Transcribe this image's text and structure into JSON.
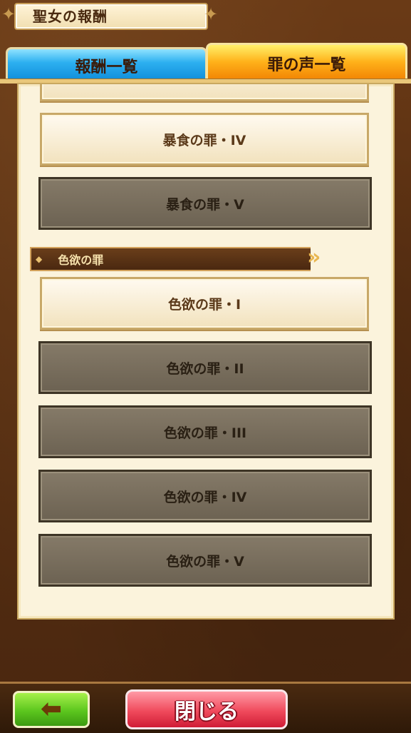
{
  "header": {
    "title": "聖女の報酬"
  },
  "tabs": [
    {
      "label": "報酬一覧",
      "color": "#2db0f0",
      "active": false
    },
    {
      "label": "罪の声一覧",
      "color": "#ffb21a",
      "active": true
    }
  ],
  "list": {
    "items_top": [
      {
        "label": "",
        "style": "light"
      },
      {
        "label": "暴食の罪・IV",
        "style": "light"
      },
      {
        "label": "暴食の罪・V",
        "style": "dark"
      }
    ],
    "section": {
      "label": "色欲の罪"
    },
    "items_section": [
      {
        "label": "色欲の罪・I",
        "style": "light"
      },
      {
        "label": "色欲の罪・II",
        "style": "dark"
      },
      {
        "label": "色欲の罪・III",
        "style": "dark"
      },
      {
        "label": "色欲の罪・IV",
        "style": "dark"
      },
      {
        "label": "色欲の罪・V",
        "style": "dark"
      }
    ]
  },
  "footer": {
    "back_icon": "left-arrow-icon",
    "close_label": "閉じる"
  },
  "colors": {
    "accent_blue": "#2db0f0",
    "accent_orange": "#f07e00",
    "back_green": "#5cc61e",
    "close_red": "#f04a5c",
    "locked_gray": "#6c6252"
  }
}
